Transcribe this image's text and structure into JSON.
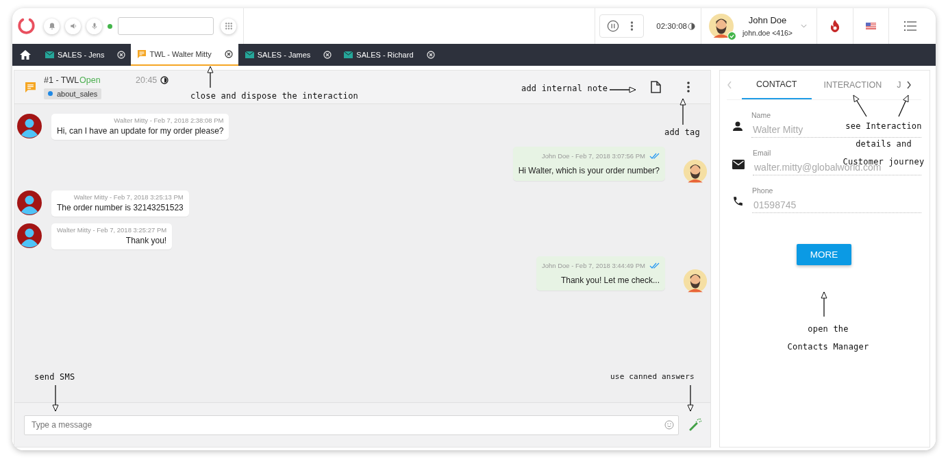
{
  "topbar": {
    "status_online": true,
    "timer": "02:30:08",
    "user": {
      "name": "John Doe",
      "login": "john.doe <416>",
      "online": true
    }
  },
  "tabs": [
    {
      "kind": "email",
      "label": "SALES - Jens",
      "selected": false
    },
    {
      "kind": "chat",
      "label": "TWL - Walter Mitty",
      "selected": true
    },
    {
      "kind": "email",
      "label": "SALES - James",
      "selected": false
    },
    {
      "kind": "email",
      "label": "SALES - Richard",
      "selected": false
    }
  ],
  "conversation": {
    "title": "#1 - TWL",
    "status": "Open",
    "time": "20:45",
    "tag": {
      "label": "about_sales",
      "color": "#1e88e5"
    }
  },
  "messages": [
    {
      "kind": "incoming",
      "meta": "Walter Mitty - Feb 7, 2018 2:38:08 PM",
      "text": "Hi, can I have an update for my order please?"
    },
    {
      "kind": "outgoing",
      "meta": "John Doe - Feb 7, 2018 3:07:56 PM",
      "text": "Hi Walter, which is your order number?",
      "read": true
    },
    {
      "kind": "incoming",
      "meta": "Walter Mitty - Feb 7, 2018 3:25:13 PM",
      "text": "The order number is 32143251523"
    },
    {
      "kind": "incoming",
      "meta": "Walter Mitty - Feb 7, 2018 3:25:27 PM",
      "text": "Thank you!"
    },
    {
      "kind": "outgoing",
      "meta": "John Doe - Feb 7, 2018 3:44:49 PM",
      "text": "Thank you! Let me check...",
      "read": true
    }
  ],
  "composer": {
    "placeholder": "Type a message"
  },
  "side_panel": {
    "tabs": [
      {
        "label": "CONTACT",
        "selected": true
      },
      {
        "label": "INTERACTION",
        "selected": false
      },
      {
        "label": "J",
        "selected": false
      }
    ],
    "fields": [
      {
        "kind": "person",
        "label": "Name",
        "value": "Walter Mitty"
      },
      {
        "kind": "email",
        "label": "Email",
        "value": "walter.mitty@globalworld.com"
      },
      {
        "kind": "phone",
        "label": "Phone",
        "value": "01598745"
      }
    ],
    "button": "MORE"
  },
  "annotations": [
    {
      "kind": "close",
      "text": "close and dispose the interaction"
    },
    {
      "kind": "note",
      "text": "add internal note"
    },
    {
      "kind": "tag",
      "text": "add tag"
    },
    {
      "kind": "details",
      "lines": [
        "see Interaction",
        "details and",
        "Customer journey"
      ]
    },
    {
      "kind": "more",
      "lines": [
        "open the",
        "Contacts Manager"
      ]
    },
    {
      "kind": "sms",
      "text": "send SMS"
    },
    {
      "kind": "canned",
      "text": "use canned answers"
    }
  ]
}
